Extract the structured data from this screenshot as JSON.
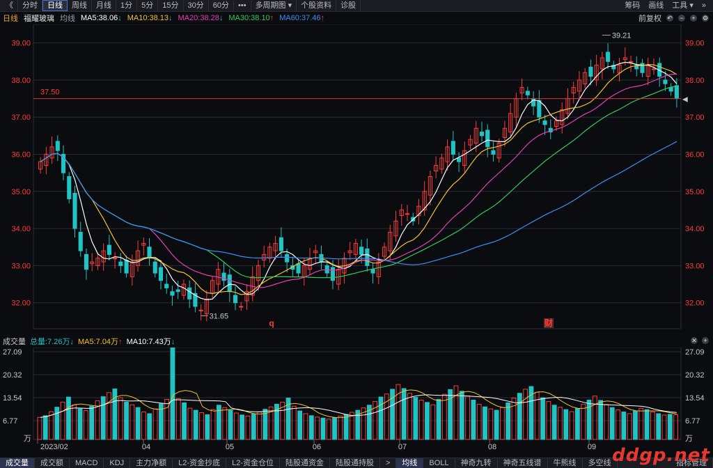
{
  "toolbar": {
    "left_items": [
      "《",
      "分时",
      "日线",
      "周线",
      "月线",
      "1分",
      "5分",
      "15分",
      "30分",
      "60分",
      "•••",
      "多周期图 ▾",
      "个股资料",
      "诊股"
    ],
    "active": "日线",
    "right_items": [
      "筹码",
      "画线",
      "工具 ▾",
      "»"
    ]
  },
  "info": {
    "period": "日线",
    "stock_name": "福耀玻璃",
    "line_mode": "均线",
    "ma5": "MA5:38.06",
    "ma10": "MA10:38.13",
    "ma20": "MA20:38.28",
    "ma30": "MA30:38.10",
    "ma60": "MA60:37.46",
    "ma5_dir": "↓",
    "ma10_dir": "↓",
    "ma20_dir": "↓",
    "ma30_dir": "↑",
    "ma60_dir": "↑",
    "adjust": "前复权"
  },
  "volume_info": {
    "label": "成交量",
    "total": "总量:7.26万",
    "total_dir": "↓",
    "ma5": "MA5:7.04万",
    "ma5_dir": "↑",
    "ma10": "MA10:7.43万",
    "ma10_dir": "↓"
  },
  "colors": {
    "up": "#ff3b3b",
    "down": "#20c4c4",
    "ma5": "#ffffff",
    "ma10": "#f2c12e",
    "ma20": "#e63fb4",
    "ma30": "#2ecc5a",
    "ma60": "#3b8ff0",
    "grid": "#2a2d35"
  },
  "chart_data": {
    "type": "candlestick",
    "y_ticks": [
      "39.00",
      "38.00",
      "37.00",
      "36.00",
      "35.00",
      "34.00",
      "33.00",
      "32.00"
    ],
    "ylim": [
      31.3,
      39.5
    ],
    "x_labels": [
      "2023/02",
      "04",
      "05",
      "06",
      "07",
      "08",
      "09"
    ],
    "price_line_label": "37.50",
    "price_line_value": 37.5,
    "high_label": "39.21",
    "high_value": 39.21,
    "low_label": "31.65",
    "low_value": 31.65,
    "markers": [
      {
        "text": "q",
        "month": "06"
      },
      {
        "text": "财",
        "month": "08"
      }
    ],
    "close_series": [
      35.8,
      36.0,
      36.2,
      36.1,
      35.5,
      34.8,
      34.0,
      33.4,
      32.9,
      33.1,
      33.2,
      33.4,
      33.3,
      33.2,
      33.0,
      32.8,
      33.1,
      33.4,
      33.6,
      33.2,
      32.8,
      32.6,
      32.4,
      32.2,
      32.3,
      32.5,
      32.1,
      31.9,
      31.8,
      32.1,
      32.6,
      32.9,
      32.6,
      32.3,
      32.0,
      31.9,
      32.3,
      32.7,
      33.0,
      33.3,
      33.5,
      33.6,
      33.4,
      33.1,
      32.9,
      32.8,
      33.0,
      33.2,
      33.4,
      33.1,
      32.8,
      32.6,
      32.9,
      33.2,
      33.4,
      33.6,
      33.3,
      33.0,
      32.8,
      33.1,
      33.5,
      33.9,
      34.2,
      34.5,
      34.4,
      34.2,
      34.6,
      35.0,
      35.4,
      35.7,
      35.9,
      36.2,
      36.0,
      35.8,
      36.1,
      36.4,
      36.7,
      36.5,
      36.2,
      36.0,
      36.3,
      36.7,
      37.1,
      37.5,
      37.8,
      37.6,
      37.3,
      37.0,
      36.8,
      36.6,
      36.9,
      37.2,
      37.5,
      37.8,
      38.0,
      38.2,
      38.1,
      38.4,
      38.6,
      38.5,
      38.3,
      38.4,
      38.6,
      38.5,
      38.3,
      38.2,
      38.4,
      38.3,
      38.1,
      37.9,
      37.7,
      37.5
    ],
    "volume": {
      "y_ticks": [
        "27.09",
        "20.32",
        "13.54",
        "6.77"
      ],
      "unit": "万",
      "ylim": [
        0,
        27.09
      ],
      "values": [
        6.5,
        7.0,
        8.2,
        9.5,
        11.0,
        12.5,
        10.2,
        9.0,
        8.5,
        9.8,
        11.4,
        12.6,
        13.8,
        14.9,
        12.3,
        11.0,
        10.2,
        9.4,
        8.1,
        7.6,
        9.0,
        10.5,
        11.8,
        27.09,
        12.0,
        10.8,
        9.2,
        8.6,
        7.9,
        7.3,
        8.8,
        10.1,
        9.4,
        8.6,
        7.8,
        7.2,
        6.9,
        7.5,
        8.1,
        8.9,
        9.6,
        10.4,
        11.0,
        12.2,
        9.8,
        8.4,
        7.6,
        7.0,
        6.6,
        6.3,
        6.0,
        6.4,
        6.9,
        7.4,
        8.0,
        8.6,
        9.3,
        10.1,
        11.2,
        12.5,
        13.4,
        14.8,
        16.2,
        15.0,
        13.6,
        12.4,
        11.6,
        10.9,
        10.2,
        11.8,
        13.3,
        14.7,
        15.8,
        14.2,
        12.8,
        11.6,
        10.4,
        9.6,
        9.0,
        8.6,
        9.4,
        10.8,
        12.2,
        13.6,
        14.8,
        15.6,
        13.9,
        12.3,
        11.2,
        10.1,
        9.5,
        8.8,
        8.2,
        9.1,
        10.4,
        11.6,
        12.8,
        11.5,
        10.3,
        9.4,
        8.7,
        8.1,
        7.6,
        8.4,
        9.2,
        8.8,
        8.1,
        7.6,
        7.2,
        7.4,
        7.26
      ]
    }
  },
  "bottom_tabs": [
    "成交量",
    "成交额",
    "MACD",
    "KDJ",
    "主力净额",
    "L2-资金抄底",
    "L2-资金仓位",
    "陆股通资金",
    "陆股通持股",
    ">",
    "均线",
    "BOLL",
    "神奇九转",
    "神奇五线谱",
    "牛熊线",
    "多空线"
  ],
  "bottom_right": "指标管理",
  "watermark": "ddgp.net"
}
